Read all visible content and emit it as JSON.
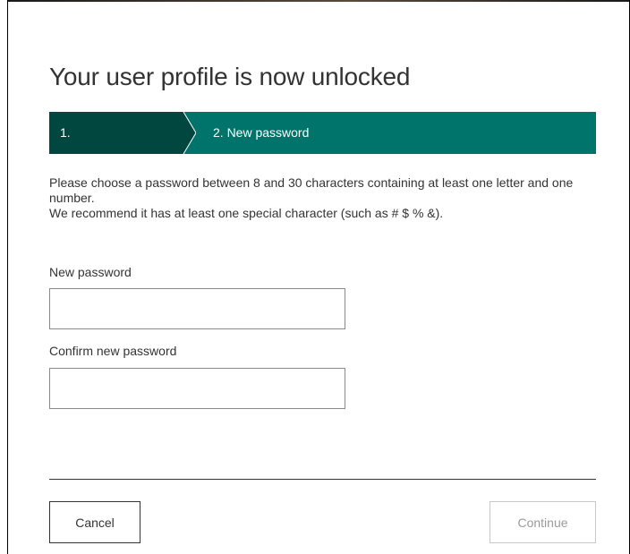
{
  "dialog": {
    "title": "Your user profile is now unlocked"
  },
  "stepper": {
    "steps": [
      {
        "label": "1."
      },
      {
        "label": "2. New password"
      }
    ],
    "colors": {
      "completed": "#01463f",
      "active": "#00736a"
    }
  },
  "instructions": {
    "line1": "Please choose a password between 8 and 30 characters containing at least one letter and one number.",
    "line2": "We recommend it has at least one special character (such as # $ % &)."
  },
  "form": {
    "new_password": {
      "label": "New password",
      "value": ""
    },
    "confirm_password": {
      "label": "Confirm new password",
      "value": ""
    }
  },
  "actions": {
    "cancel_label": "Cancel",
    "continue_label": "Continue"
  }
}
